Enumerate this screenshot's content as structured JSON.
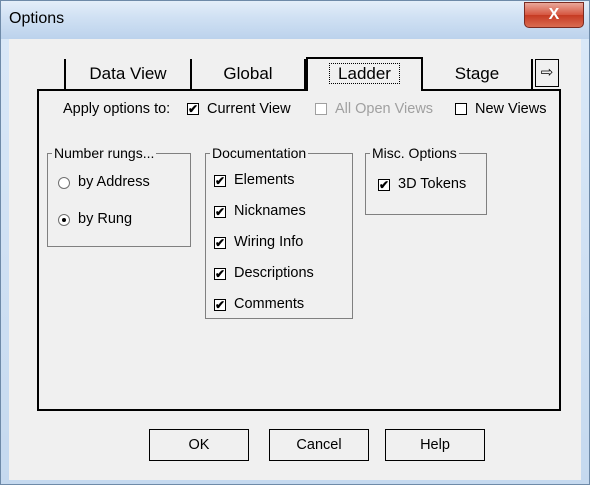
{
  "window": {
    "title": "Options",
    "close_label": "X"
  },
  "tabs": [
    {
      "label": "Data View",
      "active": false
    },
    {
      "label": "Global",
      "active": false
    },
    {
      "label": "Ladder",
      "active": true
    },
    {
      "label": "Stage",
      "active": false
    }
  ],
  "tab_scroll_icon": "⇨",
  "apply": {
    "label": "Apply options to:",
    "options": [
      {
        "label": "Current View",
        "checked": true,
        "enabled": true
      },
      {
        "label": "All Open Views",
        "checked": false,
        "enabled": false
      },
      {
        "label": "New Views",
        "checked": false,
        "enabled": true
      }
    ]
  },
  "number_rungs": {
    "title": "Number rungs...",
    "options": [
      {
        "label": "by Address",
        "selected": false
      },
      {
        "label": "by Rung",
        "selected": true
      }
    ]
  },
  "documentation": {
    "title": "Documentation",
    "items": [
      {
        "label": "Elements",
        "checked": true
      },
      {
        "label": "Nicknames",
        "checked": true
      },
      {
        "label": "Wiring Info",
        "checked": true
      },
      {
        "label": "Descriptions",
        "checked": true
      },
      {
        "label": "Comments",
        "checked": true
      }
    ]
  },
  "misc": {
    "title": "Misc. Options",
    "items": [
      {
        "label": "3D Tokens",
        "checked": true
      }
    ]
  },
  "buttons": {
    "ok": "OK",
    "cancel": "Cancel",
    "help": "Help"
  }
}
